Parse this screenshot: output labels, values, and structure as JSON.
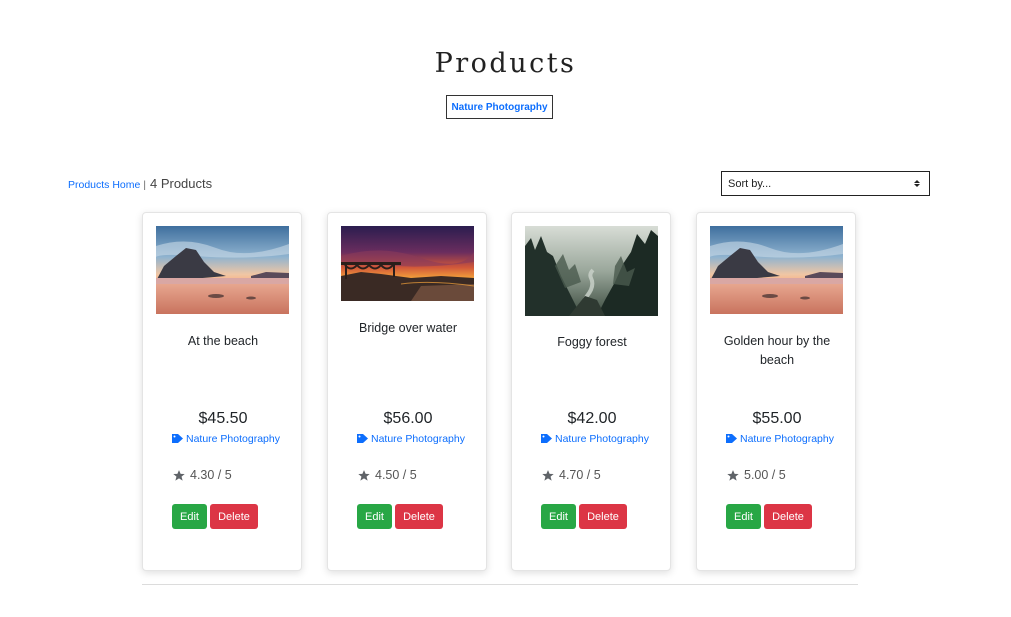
{
  "header": {
    "title": "Products",
    "category_badge": "Nature Photography"
  },
  "toolbar": {
    "breadcrumb_link": "Products Home",
    "separator": "|",
    "product_count": "4 Products",
    "sort_label": "Sort by..."
  },
  "colors": {
    "link": "#0d6efd",
    "edit_button": "#28a745",
    "delete_button": "#dc3545"
  },
  "products": [
    {
      "name": "At the beach",
      "price": "$45.50",
      "category": "Nature Photography",
      "rating": "4.30 / 5",
      "image": "beach-sunset-photo",
      "edit_label": "Edit",
      "delete_label": "Delete"
    },
    {
      "name": "Bridge over water",
      "price": "$56.00",
      "category": "Nature Photography",
      "rating": "4.50 / 5",
      "image": "coastal-bridge-sunset-photo",
      "edit_label": "Edit",
      "delete_label": "Delete"
    },
    {
      "name": "Foggy forest",
      "price": "$42.00",
      "category": "Nature Photography",
      "rating": "4.70 / 5",
      "image": "foggy-forest-river-photo",
      "edit_label": "Edit",
      "delete_label": "Delete"
    },
    {
      "name": "Golden hour by the beach",
      "price": "$55.00",
      "category": "Nature Photography",
      "rating": "5.00 / 5",
      "image": "beach-sunset-photo",
      "edit_label": "Edit",
      "delete_label": "Delete"
    }
  ]
}
